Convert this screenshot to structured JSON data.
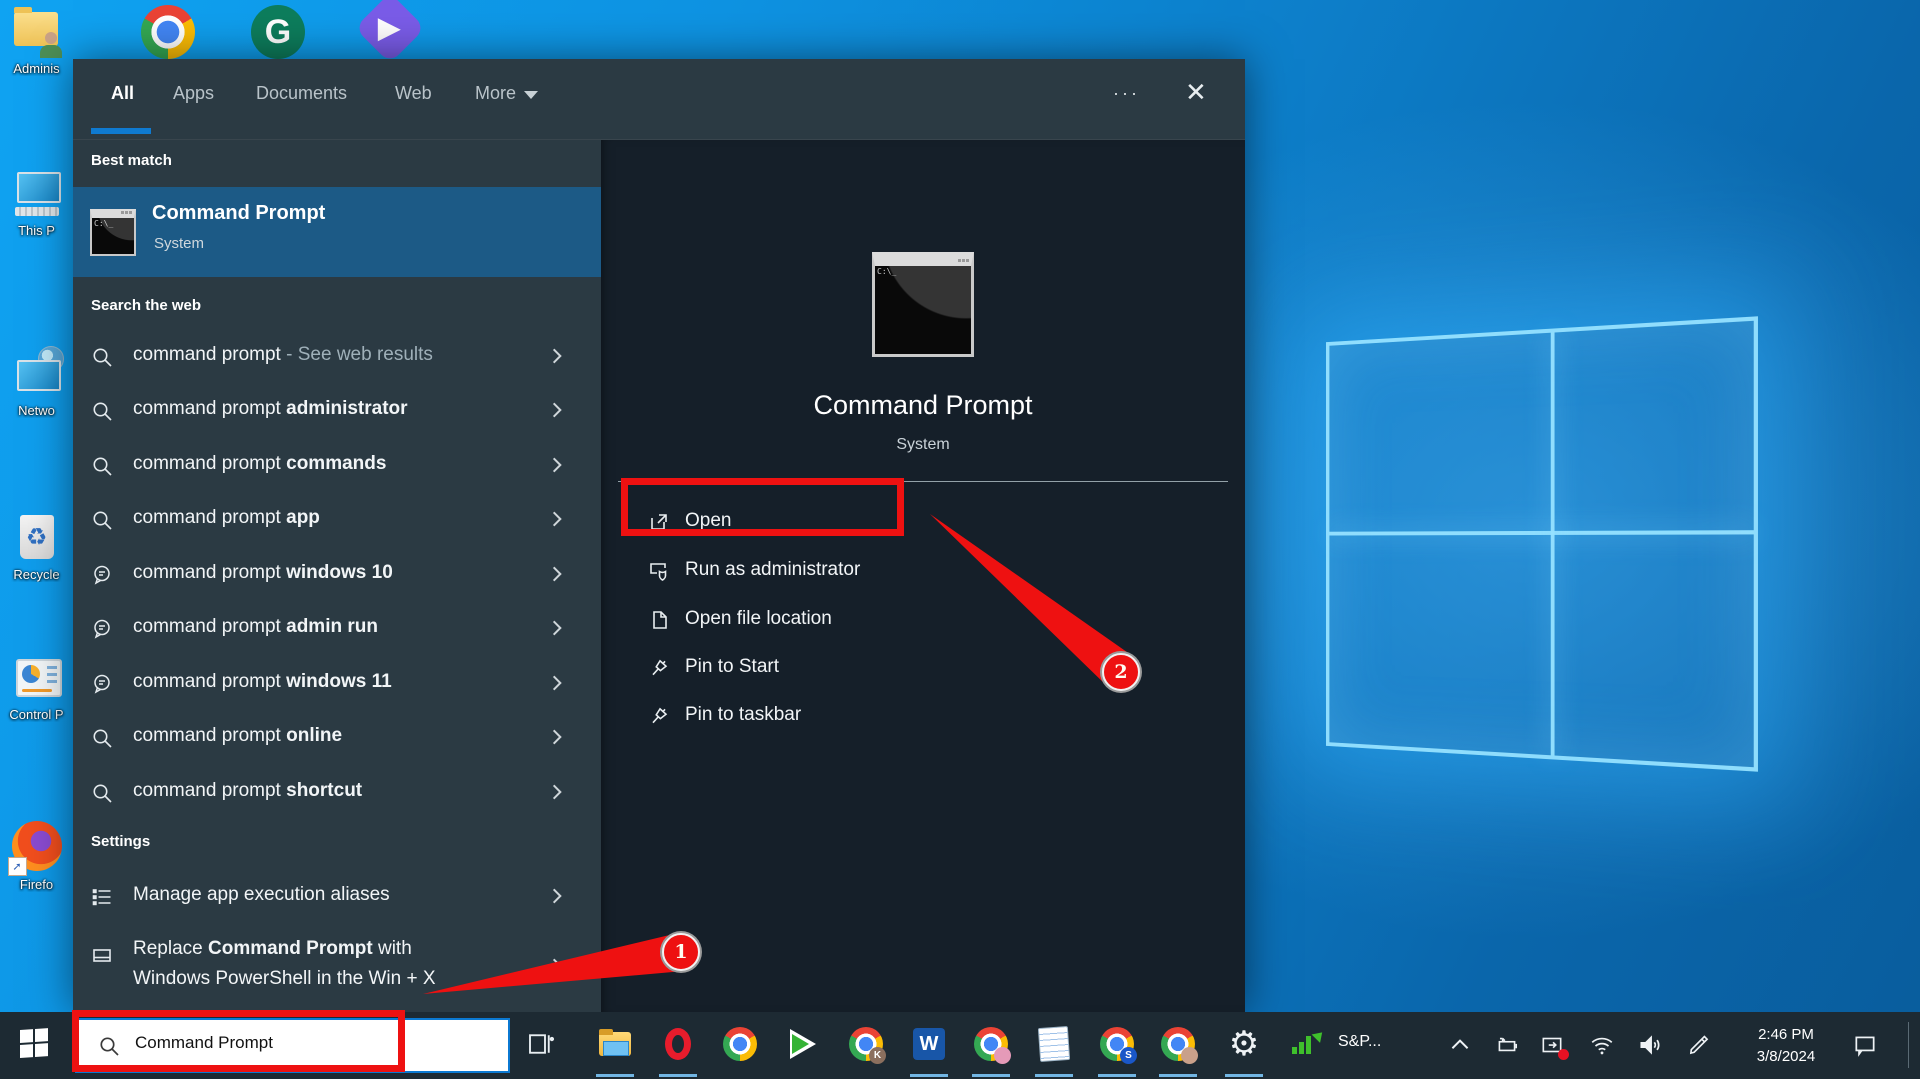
{
  "desktop": {
    "icons": [
      {
        "label": "Adminis"
      },
      {
        "label": "This P"
      },
      {
        "label": "Netwo"
      },
      {
        "label": "Recycle"
      },
      {
        "label": "Control P"
      },
      {
        "label": "Firefo"
      }
    ],
    "grammarly_letter": "G",
    "recycle_glyph": "♻",
    "shortcut_arrow_glyph": "➚",
    "play_glyph": "▶"
  },
  "search_panel": {
    "tabs": [
      {
        "label": "All"
      },
      {
        "label": "Apps"
      },
      {
        "label": "Documents"
      },
      {
        "label": "Web"
      },
      {
        "label": "More"
      }
    ],
    "ellipsis": "···",
    "close_glyph": "✕",
    "best_match": {
      "header": "Best match",
      "title": "Command Prompt",
      "subtitle": "System"
    },
    "web_section": {
      "header": "Search the web",
      "items": [
        {
          "icon": "search-icon",
          "text": "command prompt",
          "bold": "",
          "dim": " - See web results"
        },
        {
          "icon": "search-icon",
          "text": "command prompt ",
          "bold": "administrator"
        },
        {
          "icon": "search-icon",
          "text": "command prompt ",
          "bold": "commands"
        },
        {
          "icon": "search-icon",
          "text": "command prompt ",
          "bold": "app"
        },
        {
          "icon": "chat-bubble-icon",
          "text": "command prompt ",
          "bold": "windows 10"
        },
        {
          "icon": "chat-bubble-icon",
          "text": "command prompt ",
          "bold": "admin run"
        },
        {
          "icon": "chat-bubble-icon",
          "text": "command prompt ",
          "bold": "windows 11"
        },
        {
          "icon": "search-icon",
          "text": "command prompt ",
          "bold": "online"
        },
        {
          "icon": "search-icon",
          "text": "command prompt ",
          "bold": "shortcut"
        }
      ]
    },
    "settings_section": {
      "header": "Settings",
      "items": [
        {
          "line1": "Manage app execution aliases"
        },
        {
          "line1_pre": "Replace ",
          "line1_bold": "Command Prompt",
          "line1_post": " with",
          "line2": "Windows PowerShell in the Win + X"
        }
      ]
    },
    "detail": {
      "title": "Command Prompt",
      "subtitle": "System",
      "actions": [
        {
          "label": "Open"
        },
        {
          "label": "Run as administrator"
        },
        {
          "label": "Open file location"
        },
        {
          "label": "Pin to Start"
        },
        {
          "label": "Pin to taskbar"
        }
      ]
    }
  },
  "annotations": {
    "step1": "1",
    "step2": "2"
  },
  "taskbar": {
    "search": {
      "value": "Command Prompt"
    },
    "word_letter": "W",
    "badge_k": "K",
    "badge_s": "S",
    "gear_glyph": "⚙",
    "tray": {
      "stock_label": "S&P...",
      "time": "2:46 PM",
      "date": "3/8/2024"
    }
  }
}
